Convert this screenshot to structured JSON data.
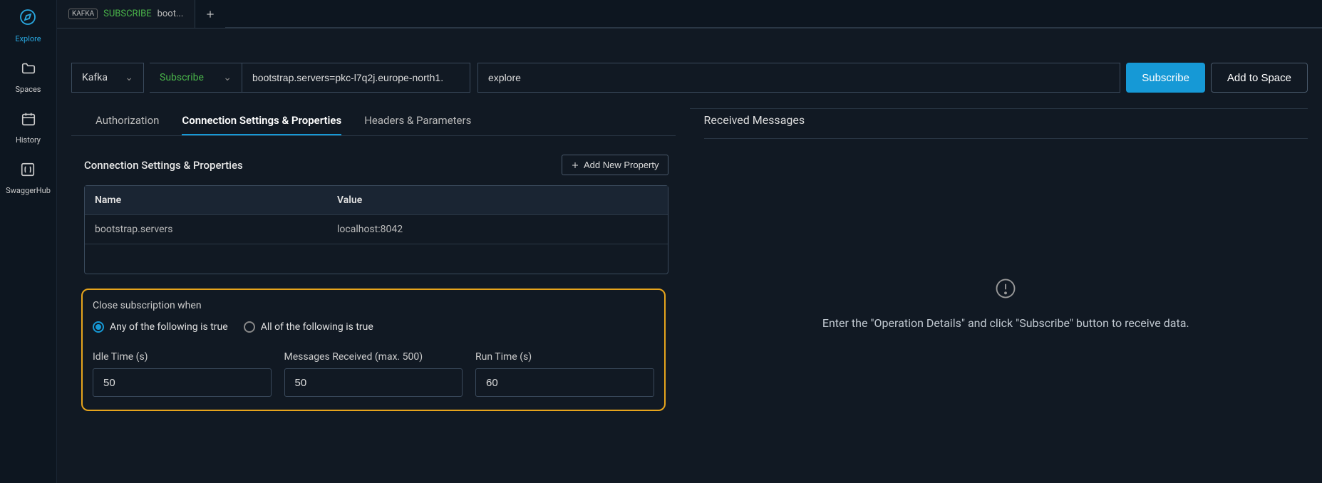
{
  "sidebar": {
    "items": [
      {
        "label": "Explore"
      },
      {
        "label": "Spaces"
      },
      {
        "label": "History"
      },
      {
        "label": "SwaggerHub"
      }
    ]
  },
  "tab": {
    "badge": "KAFKA",
    "subscribe": "SUBSCRIBE",
    "boot": "boot..."
  },
  "url": {
    "protocol": "Kafka",
    "operation": "Subscribe",
    "server": "bootstrap.servers=pkc-l7q2j.europe-north1.",
    "topic": "explore"
  },
  "buttons": {
    "subscribe": "Subscribe",
    "addSpace": "Add to Space",
    "addProp": "Add New Property"
  },
  "subtabs": {
    "auth": "Authorization",
    "conn": "Connection Settings & Properties",
    "headers": "Headers & Parameters"
  },
  "section": {
    "title": "Connection Settings & Properties"
  },
  "tableHead": {
    "name": "Name",
    "value": "Value"
  },
  "props": [
    {
      "name": "bootstrap.servers",
      "value": "localhost:8042"
    }
  ],
  "closeBox": {
    "title": "Close subscription when",
    "anyLabel": "Any of the following is true",
    "allLabel": "All of the following is true",
    "idleLabel": "Idle Time (s)",
    "idleVal": "50",
    "msgLabel": "Messages Received (max. 500)",
    "msgVal": "50",
    "runLabel": "Run Time (s)",
    "runVal": "60"
  },
  "right": {
    "title": "Received Messages",
    "empty": "Enter the \"Operation Details\" and click \"Subscribe\" button to receive data."
  }
}
